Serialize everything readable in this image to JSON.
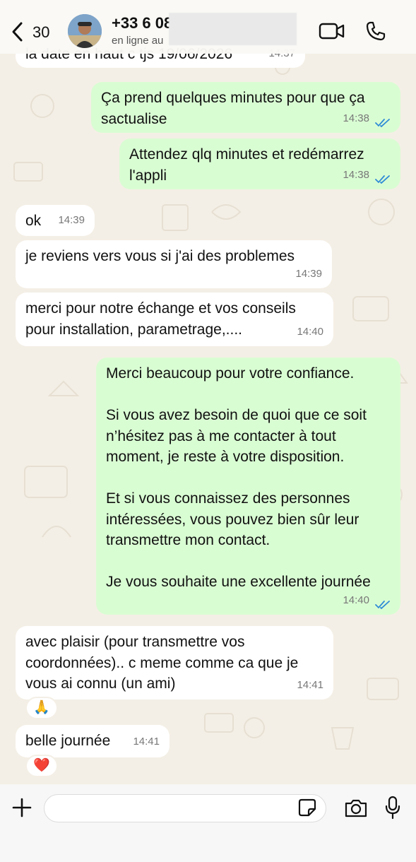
{
  "header": {
    "back_count": "30",
    "contact_name": "+33 6 08",
    "status": "en ligne au"
  },
  "messages": [
    {
      "dir": "in",
      "text": "la date en haut c tjs 19/06/2026",
      "time": "14:37"
    },
    {
      "dir": "out",
      "text": "Ça prend quelques minutes pour que ça\nsactualise",
      "time": "14:38",
      "read": true
    },
    {
      "dir": "out",
      "text": "Attendez qlq minutes et redémarrez\nl'appli",
      "time": "14:38",
      "read": true
    },
    {
      "dir": "in",
      "text": "ok",
      "time": "14:39"
    },
    {
      "dir": "in",
      "text": "je reviens vers vous si j'ai des problemes",
      "time": "14:39"
    },
    {
      "dir": "in",
      "text": "merci pour notre échange et vos conseils\npour installation, parametrage,....",
      "time": "14:40"
    },
    {
      "dir": "out",
      "text": "Merci beaucoup pour votre confiance.\n\nSi vous avez besoin de quoi que ce soit\nn’hésitez pas à me contacter à tout\nmoment, je reste à votre disposition.\n\nEt si vous connaissez des personnes\nintéressées, vous pouvez bien sûr leur\ntransmettre mon contact.\n\nJe vous souhaite une excellente journée",
      "time": "14:40",
      "read": true
    },
    {
      "dir": "in",
      "text": "avec plaisir (pour transmettre vos\ncoordonnées).. c meme comme ca que je\nvous ai connu (un ami)",
      "time": "14:41",
      "reaction": "🙏"
    },
    {
      "dir": "in",
      "text": "belle journée",
      "time": "14:41",
      "reaction": "❤️"
    }
  ],
  "input": {
    "placeholder": ""
  },
  "colors": {
    "incoming": "#ffffff",
    "outgoing": "#d9fdd3",
    "read_ticks": "#2f8bd6",
    "wallpaper": "#f4efe6"
  }
}
